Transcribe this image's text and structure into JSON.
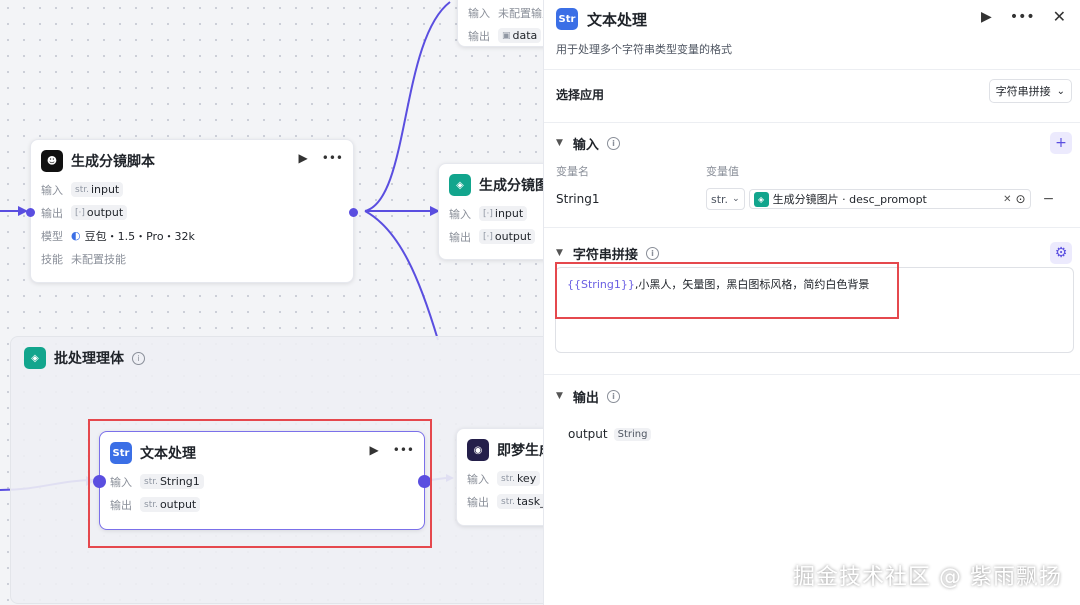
{
  "canvas": {
    "top_partial_node": {
      "input_label": "输入",
      "input_value": "未配置输入",
      "output_label": "输出",
      "output_value": "data"
    },
    "script_node": {
      "title": "生成分镜脚本",
      "input_label": "输入",
      "input_prefix": "str.",
      "input_value": "input",
      "output_label": "输出",
      "output_prefix": "[·]",
      "output_value": "output",
      "model_label": "模型",
      "model_value": "豆包・1.5・Pro・32k",
      "skill_label": "技能",
      "skill_value": "未配置技能",
      "icon": "robot-icon"
    },
    "image_node": {
      "title": "生成分镜图",
      "input_label": "输入",
      "input_prefix": "[·]",
      "input_value": "input",
      "output_label": "输出",
      "output_prefix": "[·]",
      "output_value": "output",
      "icon": "layers-icon"
    },
    "batch_group": {
      "title": "批处理理体",
      "icon": "layers-icon"
    },
    "text_node": {
      "title": "文本处理",
      "input_label": "输入",
      "input_prefix": "str.",
      "input_value": "String1",
      "output_label": "输出",
      "output_prefix": "str.",
      "output_value": "output",
      "icon": "str-icon"
    },
    "jimeng_node": {
      "title": "即梦生成",
      "input_label": "输入",
      "input_prefix": "str.",
      "input_value": "key",
      "output_label": "输出",
      "output_prefix": "str.",
      "output_value": "task_id"
    }
  },
  "panel": {
    "title": "文本处理",
    "icon_text": "Str",
    "description": "用于处理多个字符串类型变量的格式",
    "app_label": "选择应用",
    "app_value": "字符串拼接",
    "input_section": {
      "title": "输入",
      "col_name": "变量名",
      "col_value": "变量值",
      "row_name": "String1",
      "row_type": "str.",
      "row_ref": "生成分镜图片 · desc_promopt"
    },
    "concat_section": {
      "title": "字符串拼接",
      "template_var": "{{String1}}",
      "template_text": ",小黑人，矢量图，黑白图标风格，简约白色背景"
    },
    "output_section": {
      "title": "输出",
      "name": "output",
      "type": "String"
    }
  },
  "watermark": "掘金技术社区 @ 紫雨飘扬",
  "colors": {
    "accent": "#5a4ee0",
    "highlight": "#e5484d",
    "teal": "#12a58d",
    "blue": "#3b6fe6"
  }
}
